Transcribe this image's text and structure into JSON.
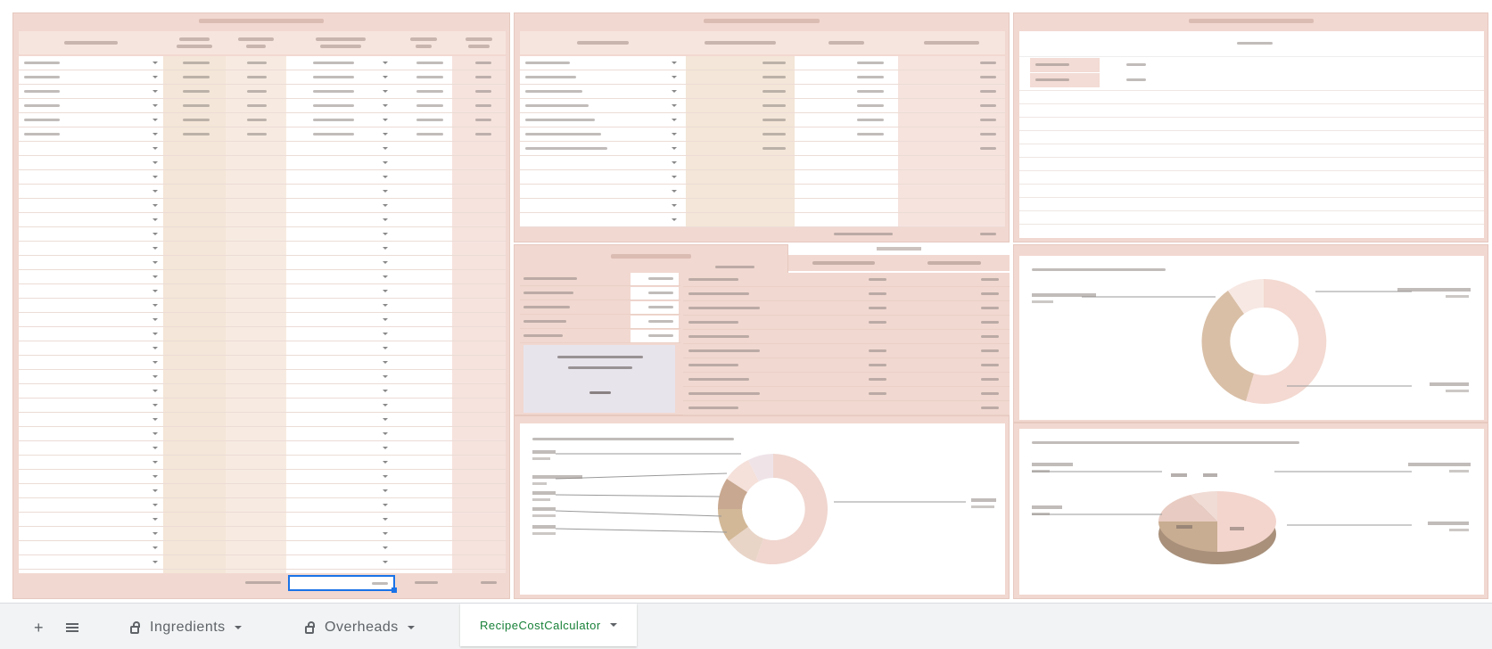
{
  "tabs": {
    "add_label": "+",
    "sheets": [
      {
        "name": "Ingredients",
        "locked": true
      },
      {
        "name": "Overheads",
        "locked": true
      },
      {
        "name": "RecipeCostCalculator",
        "locked": false
      }
    ],
    "active": "RecipeCostCalculator"
  },
  "panels": {
    "recipe_cost_calculator": {
      "title": "",
      "columns": [
        "",
        "",
        "",
        "",
        "",
        ""
      ],
      "rows": [
        {
          "ingredient": "",
          "unit": "",
          "cost": "",
          "recipe_unit": "",
          "qty": "",
          "recipe_cost": ""
        },
        {
          "ingredient": "",
          "unit": "",
          "cost": "",
          "recipe_unit": "",
          "qty": "",
          "recipe_cost": ""
        },
        {
          "ingredient": "",
          "unit": "",
          "cost": "",
          "recipe_unit": "",
          "qty": "",
          "recipe_cost": ""
        },
        {
          "ingredient": "",
          "unit": "",
          "cost": "",
          "recipe_unit": "",
          "qty": "",
          "recipe_cost": ""
        },
        {
          "ingredient": "",
          "unit": "",
          "cost": "",
          "recipe_unit": "",
          "qty": "",
          "recipe_cost": ""
        },
        {
          "ingredient": "",
          "unit": "",
          "cost": "",
          "recipe_unit": "",
          "qty": "",
          "recipe_cost": ""
        }
      ],
      "servings_label": "",
      "servings_value": "",
      "total_label": "",
      "total_value": ""
    },
    "overhead_calculator": {
      "title": "",
      "columns": [
        "",
        "",
        "",
        ""
      ],
      "rows": [
        {
          "overhead": "",
          "amount": "",
          "percent": "",
          "total": ""
        },
        {
          "overhead": "",
          "amount": "",
          "percent": "",
          "total": ""
        },
        {
          "overhead": "",
          "amount": "",
          "percent": "",
          "total": ""
        },
        {
          "overhead": "",
          "amount": "",
          "percent": "",
          "total": ""
        },
        {
          "overhead": "",
          "amount": "",
          "percent": "",
          "total": ""
        },
        {
          "overhead": "",
          "amount": "",
          "percent": "",
          "total": ""
        },
        {
          "overhead": "",
          "amount": "",
          "percent": "",
          "total": ""
        }
      ],
      "total_label": "",
      "total_value": ""
    },
    "description": {
      "title": "",
      "heading": "",
      "rows": [
        {
          "label": "",
          "value": ""
        },
        {
          "label": "",
          "value": ""
        }
      ]
    },
    "markup_labor": {
      "title": "",
      "rows": [
        {
          "label": "",
          "value": ""
        },
        {
          "label": "",
          "value": ""
        },
        {
          "label": "",
          "value": ""
        },
        {
          "label": "",
          "value": ""
        },
        {
          "label": "",
          "value": ""
        }
      ],
      "price_label": "",
      "price_value": ""
    },
    "summary": {
      "title": "",
      "columns": [
        "",
        "",
        ""
      ],
      "rows": [
        {
          "label": "",
          "without": "",
          "with": ""
        },
        {
          "label": "",
          "without": "",
          "with": ""
        },
        {
          "label": "",
          "without": "",
          "with": ""
        },
        {
          "label": "",
          "without": "",
          "with": ""
        },
        {
          "label": "",
          "without": "",
          "with": ""
        },
        {
          "label": "",
          "without": "",
          "with": ""
        },
        {
          "label": "",
          "without": "",
          "with": ""
        },
        {
          "label": "",
          "without": "",
          "with": ""
        },
        {
          "label": "",
          "without": "",
          "with": ""
        },
        {
          "label": "",
          "without": "",
          "with": ""
        }
      ]
    },
    "charts": {
      "recipe_cost_markup": {
        "title": "",
        "labels": [
          "",
          "",
          ""
        ],
        "colors": [
          "#f3d9d1",
          "#d9bfa6",
          "#f7e8e3"
        ]
      },
      "ingredients_breakdown": {
        "title": "",
        "labels": [
          "",
          "",
          "",
          "",
          "",
          ""
        ],
        "colors": [
          "#f0d6cf",
          "#d2b897",
          "#c8a890",
          "#b49a7d",
          "#e9d5c8",
          "#f5e0da"
        ]
      },
      "serving_price_breakdown": {
        "title": "",
        "labels": [
          "",
          "",
          "",
          ""
        ],
        "colors": [
          "#f3d5cd",
          "#c9ad92",
          "#e8cbc2",
          "#a8907b"
        ]
      }
    }
  }
}
